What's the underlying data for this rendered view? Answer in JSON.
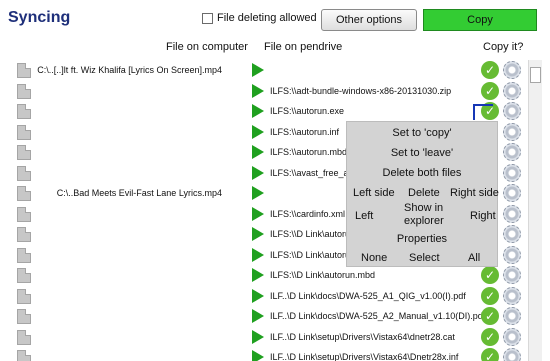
{
  "header": {
    "title": "Syncing",
    "file_deleting_label": "File deleting allowed",
    "other_options_label": "Other options",
    "copy_label": "Copy"
  },
  "columns": {
    "computer": "File on computer",
    "pendrive": "File on pendrive",
    "copy": "Copy it?"
  },
  "rows": [
    {
      "src": "C:\\..[..]lt ft. Wiz Khalifa [Lyrics On Screen].mp4",
      "dst": "",
      "ok": true
    },
    {
      "src": "",
      "dst": "ILFS:\\\\adt-bundle-windows-x86-20131030.zip",
      "ok": true
    },
    {
      "src": "",
      "dst": "ILFS:\\\\autorun.exe",
      "ok": true
    },
    {
      "src": "",
      "dst": "ILFS:\\\\autorun.inf",
      "ok": false
    },
    {
      "src": "",
      "dst": "ILFS:\\\\autorun.mbd",
      "ok": false
    },
    {
      "src": "",
      "dst": "ILFS:\\\\avast_free_a",
      "ok": false
    },
    {
      "src": "C:\\..Bad Meets Evil-Fast Lane Lyrics.mp4",
      "dst": "",
      "ok": false
    },
    {
      "src": "",
      "dst": "ILFS:\\\\cardinfo.xml",
      "ok": false
    },
    {
      "src": "",
      "dst": "ILFS:\\\\D Link\\autorun",
      "ok": false
    },
    {
      "src": "",
      "dst": "ILFS:\\\\D Link\\autorun",
      "ok": false
    },
    {
      "src": "",
      "dst": "ILFS:\\\\D Link\\autorun.mbd",
      "ok": true
    },
    {
      "src": "",
      "dst": "ILF..\\D Link\\docs\\DWA-525_A1_QIG_v1.00(I).pdf",
      "ok": true
    },
    {
      "src": "",
      "dst": "ILF..\\D Link\\docs\\DWA-525_A2_Manual_v1.10(DI).pdf",
      "ok": true
    },
    {
      "src": "",
      "dst": "ILF..\\D Link\\setup\\Drivers\\Vistax64\\dnetr28.cat",
      "ok": true
    },
    {
      "src": "",
      "dst": "ILF..\\D Link\\setup\\Drivers\\Vistax64\\Dnetr28x.inf",
      "ok": true
    }
  ],
  "context_menu": {
    "set_copy": "Set to 'copy'",
    "set_leave": "Set to 'leave'",
    "delete_both": "Delete both files",
    "left_side": "Left side",
    "delete": "Delete",
    "right_side": "Right side",
    "left": "Left",
    "show_in_explorer_1": "Show in",
    "show_in_explorer_2": "explorer",
    "right": "Right",
    "properties": "Properties",
    "none": "None",
    "select": "Select",
    "all": "All"
  },
  "colors": {
    "title": "#1e2f7a",
    "copy_button": "#33cc33",
    "arrow": "#1fa01f",
    "check": "#66bb33",
    "menu_bg": "#d3d3d3"
  }
}
